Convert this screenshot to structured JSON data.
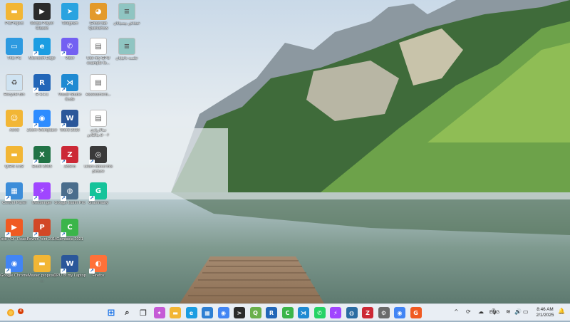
{
  "desktop": {
    "icons": [
      {
        "label": "PolProject",
        "icon": "folder-icon",
        "color": "#f2b635"
      },
      {
        "label": "Media Player Classic",
        "icon": "media-player-classic-icon",
        "color": "#2b2b2b"
      },
      {
        "label": "Telegram",
        "icon": "telegram-icon",
        "color": "#2aa3e0"
      },
      {
        "label": "Ghost tab Quickshow",
        "icon": "ghost-app-icon",
        "color": "#e39a2b"
      },
      {
        "label": "خشاش بیسیابان",
        "icon": "folder-teal-icon",
        "color": "#8fc5c2"
      },
      {
        "label": "This PC",
        "icon": "this-pc-icon",
        "color": "#2d9ae0"
      },
      {
        "label": "Microsoft Edge",
        "icon": "edge-icon",
        "color": "#1b9de2"
      },
      {
        "label": "Viber",
        "icon": "viber-icon",
        "color": "#7360f2"
      },
      {
        "label": "Use my GPU example fo...",
        "icon": "text-file-icon",
        "color": "#ffffff"
      },
      {
        "label": "جلسه دانيايان",
        "icon": "folder-teal-icon",
        "color": "#8fc5c2"
      },
      {
        "label": "Recycle Bin",
        "icon": "recycle-bin-icon",
        "color": "#cfe3f2"
      },
      {
        "label": "R 4.4.1",
        "icon": "r-icon",
        "color": "#2266b8"
      },
      {
        "label": "Visual Studio Code",
        "icon": "vscode-icon",
        "color": "#1f8ad2"
      },
      {
        "label": "Assessment...",
        "icon": "document-icon",
        "color": "#ffffff"
      },
      {
        "label": "Aeed",
        "icon": "user-folder-icon",
        "color": "#f2b635"
      },
      {
        "label": "Zoom Workplace",
        "icon": "zoom-icon",
        "color": "#2d8cff"
      },
      {
        "label": "Word 2016",
        "icon": "word-icon",
        "color": "#2b579a"
      },
      {
        "label": "سالاریادی ۵۰۰۶،مالکادو",
        "icon": "document-icon",
        "color": "#ffffff"
      },
      {
        "label": "QGIS 3.32",
        "icon": "folder-icon",
        "color": "#f2b635"
      },
      {
        "label": "Excel 2016",
        "icon": "excel-icon",
        "color": "#217346"
      },
      {
        "label": "Zotero",
        "icon": "zotero-icon",
        "color": "#cc2936"
      },
      {
        "label": "Learn about this picture",
        "icon": "camera-icon",
        "color": "#3a3a3a"
      },
      {
        "label": "Control Panel",
        "icon": "control-panel-icon",
        "color": "#3c8dd9"
      },
      {
        "label": "Messenger",
        "icon": "messenger-icon",
        "color": "#a046ff"
      },
      {
        "label": "Google Earth Pro",
        "icon": "google-earth-icon",
        "color": "#4a6d8c"
      },
      {
        "label": "Grammarly",
        "icon": "grammarly-icon",
        "color": "#15c39a"
      },
      {
        "label": "Foxit PDF Reader",
        "icon": "foxit-icon",
        "color": "#f05a22"
      },
      {
        "label": "PowerPoint 2016",
        "icon": "powerpoint-icon",
        "color": "#d24726"
      },
      {
        "label": "Camtasia 2021",
        "icon": "camtasia-icon",
        "color": "#3bb54a"
      },
      {
        "label": "Google Chrome",
        "icon": "chrome-icon",
        "color": "#4285f4"
      },
      {
        "label": "Master proposal ...",
        "icon": "folder-icon",
        "color": "#f2b635"
      },
      {
        "label": "CPU of my Laptop",
        "icon": "word-doc-icon",
        "color": "#2b579a"
      },
      {
        "label": "Firefox",
        "icon": "firefox-icon",
        "color": "#ff7139"
      }
    ]
  },
  "taskbar": {
    "weather_icon": "weather-icon",
    "weather_badge": "4",
    "apps": [
      {
        "name": "start",
        "icon": "windows-start-icon",
        "color": "#1a73e8",
        "glyph": "⊞"
      },
      {
        "name": "search",
        "icon": "search-icon",
        "color": "#333333",
        "glyph": "⌕"
      },
      {
        "name": "task-view",
        "icon": "task-view-icon",
        "color": "#333333",
        "glyph": "❐"
      },
      {
        "name": "copilot",
        "icon": "copilot-icon",
        "color": "#c55bd6",
        "glyph": "✦"
      },
      {
        "name": "file-explorer",
        "icon": "file-explorer-icon",
        "color": "#f2b635",
        "glyph": "▬"
      },
      {
        "name": "edge",
        "icon": "edge-icon",
        "color": "#1b9de2",
        "glyph": "e"
      },
      {
        "name": "store",
        "icon": "store-icon",
        "color": "#2d7fd3",
        "glyph": "▦"
      },
      {
        "name": "chrome",
        "icon": "chrome-icon",
        "color": "#4285f4",
        "glyph": "◉"
      },
      {
        "name": "terminal",
        "icon": "terminal-icon",
        "color": "#2b2b2b",
        "glyph": ">"
      },
      {
        "name": "qgis",
        "icon": "qgis-icon",
        "color": "#6ab04c",
        "glyph": "Q"
      },
      {
        "name": "r",
        "icon": "r-icon",
        "color": "#2266b8",
        "glyph": "R"
      },
      {
        "name": "camtasia",
        "icon": "camtasia-icon",
        "color": "#3bb54a",
        "glyph": "C"
      },
      {
        "name": "vscode",
        "icon": "vscode-icon",
        "color": "#1f8ad2",
        "glyph": "⋊"
      },
      {
        "name": "whatsapp",
        "icon": "whatsapp-icon",
        "color": "#25d366",
        "glyph": "✆"
      },
      {
        "name": "messenger",
        "icon": "messenger-icon",
        "color": "#a046ff",
        "glyph": "⚡"
      },
      {
        "name": "google-earth",
        "icon": "google-earth-icon",
        "color": "#2b6ca3",
        "glyph": "◍"
      },
      {
        "name": "zotero",
        "icon": "zotero-icon",
        "color": "#cc2936",
        "glyph": "Z"
      },
      {
        "name": "settings",
        "icon": "gear-icon",
        "color": "#6b6b6b",
        "glyph": "⚙"
      },
      {
        "name": "chrome-2",
        "icon": "chrome-icon",
        "color": "#4285f4",
        "glyph": "◉"
      },
      {
        "name": "foxit",
        "icon": "foxit-icon",
        "color": "#f05a22",
        "glyph": "G"
      }
    ],
    "tray": [
      {
        "icon": "chevron-up-icon",
        "glyph": "^"
      },
      {
        "icon": "sync-icon",
        "glyph": "⟳"
      },
      {
        "icon": "onedrive-icon",
        "glyph": "☁"
      },
      {
        "icon": "microphone-icon",
        "glyph": "🎙"
      }
    ],
    "language": "ENG",
    "status_icons": [
      {
        "icon": "wifi-icon",
        "glyph": "≋"
      },
      {
        "icon": "volume-icon",
        "glyph": "🔊"
      },
      {
        "icon": "battery-icon",
        "glyph": "▭"
      }
    ],
    "time": "8:46 AM",
    "date": "2/1/2025",
    "notification_icon": "bell-icon"
  }
}
